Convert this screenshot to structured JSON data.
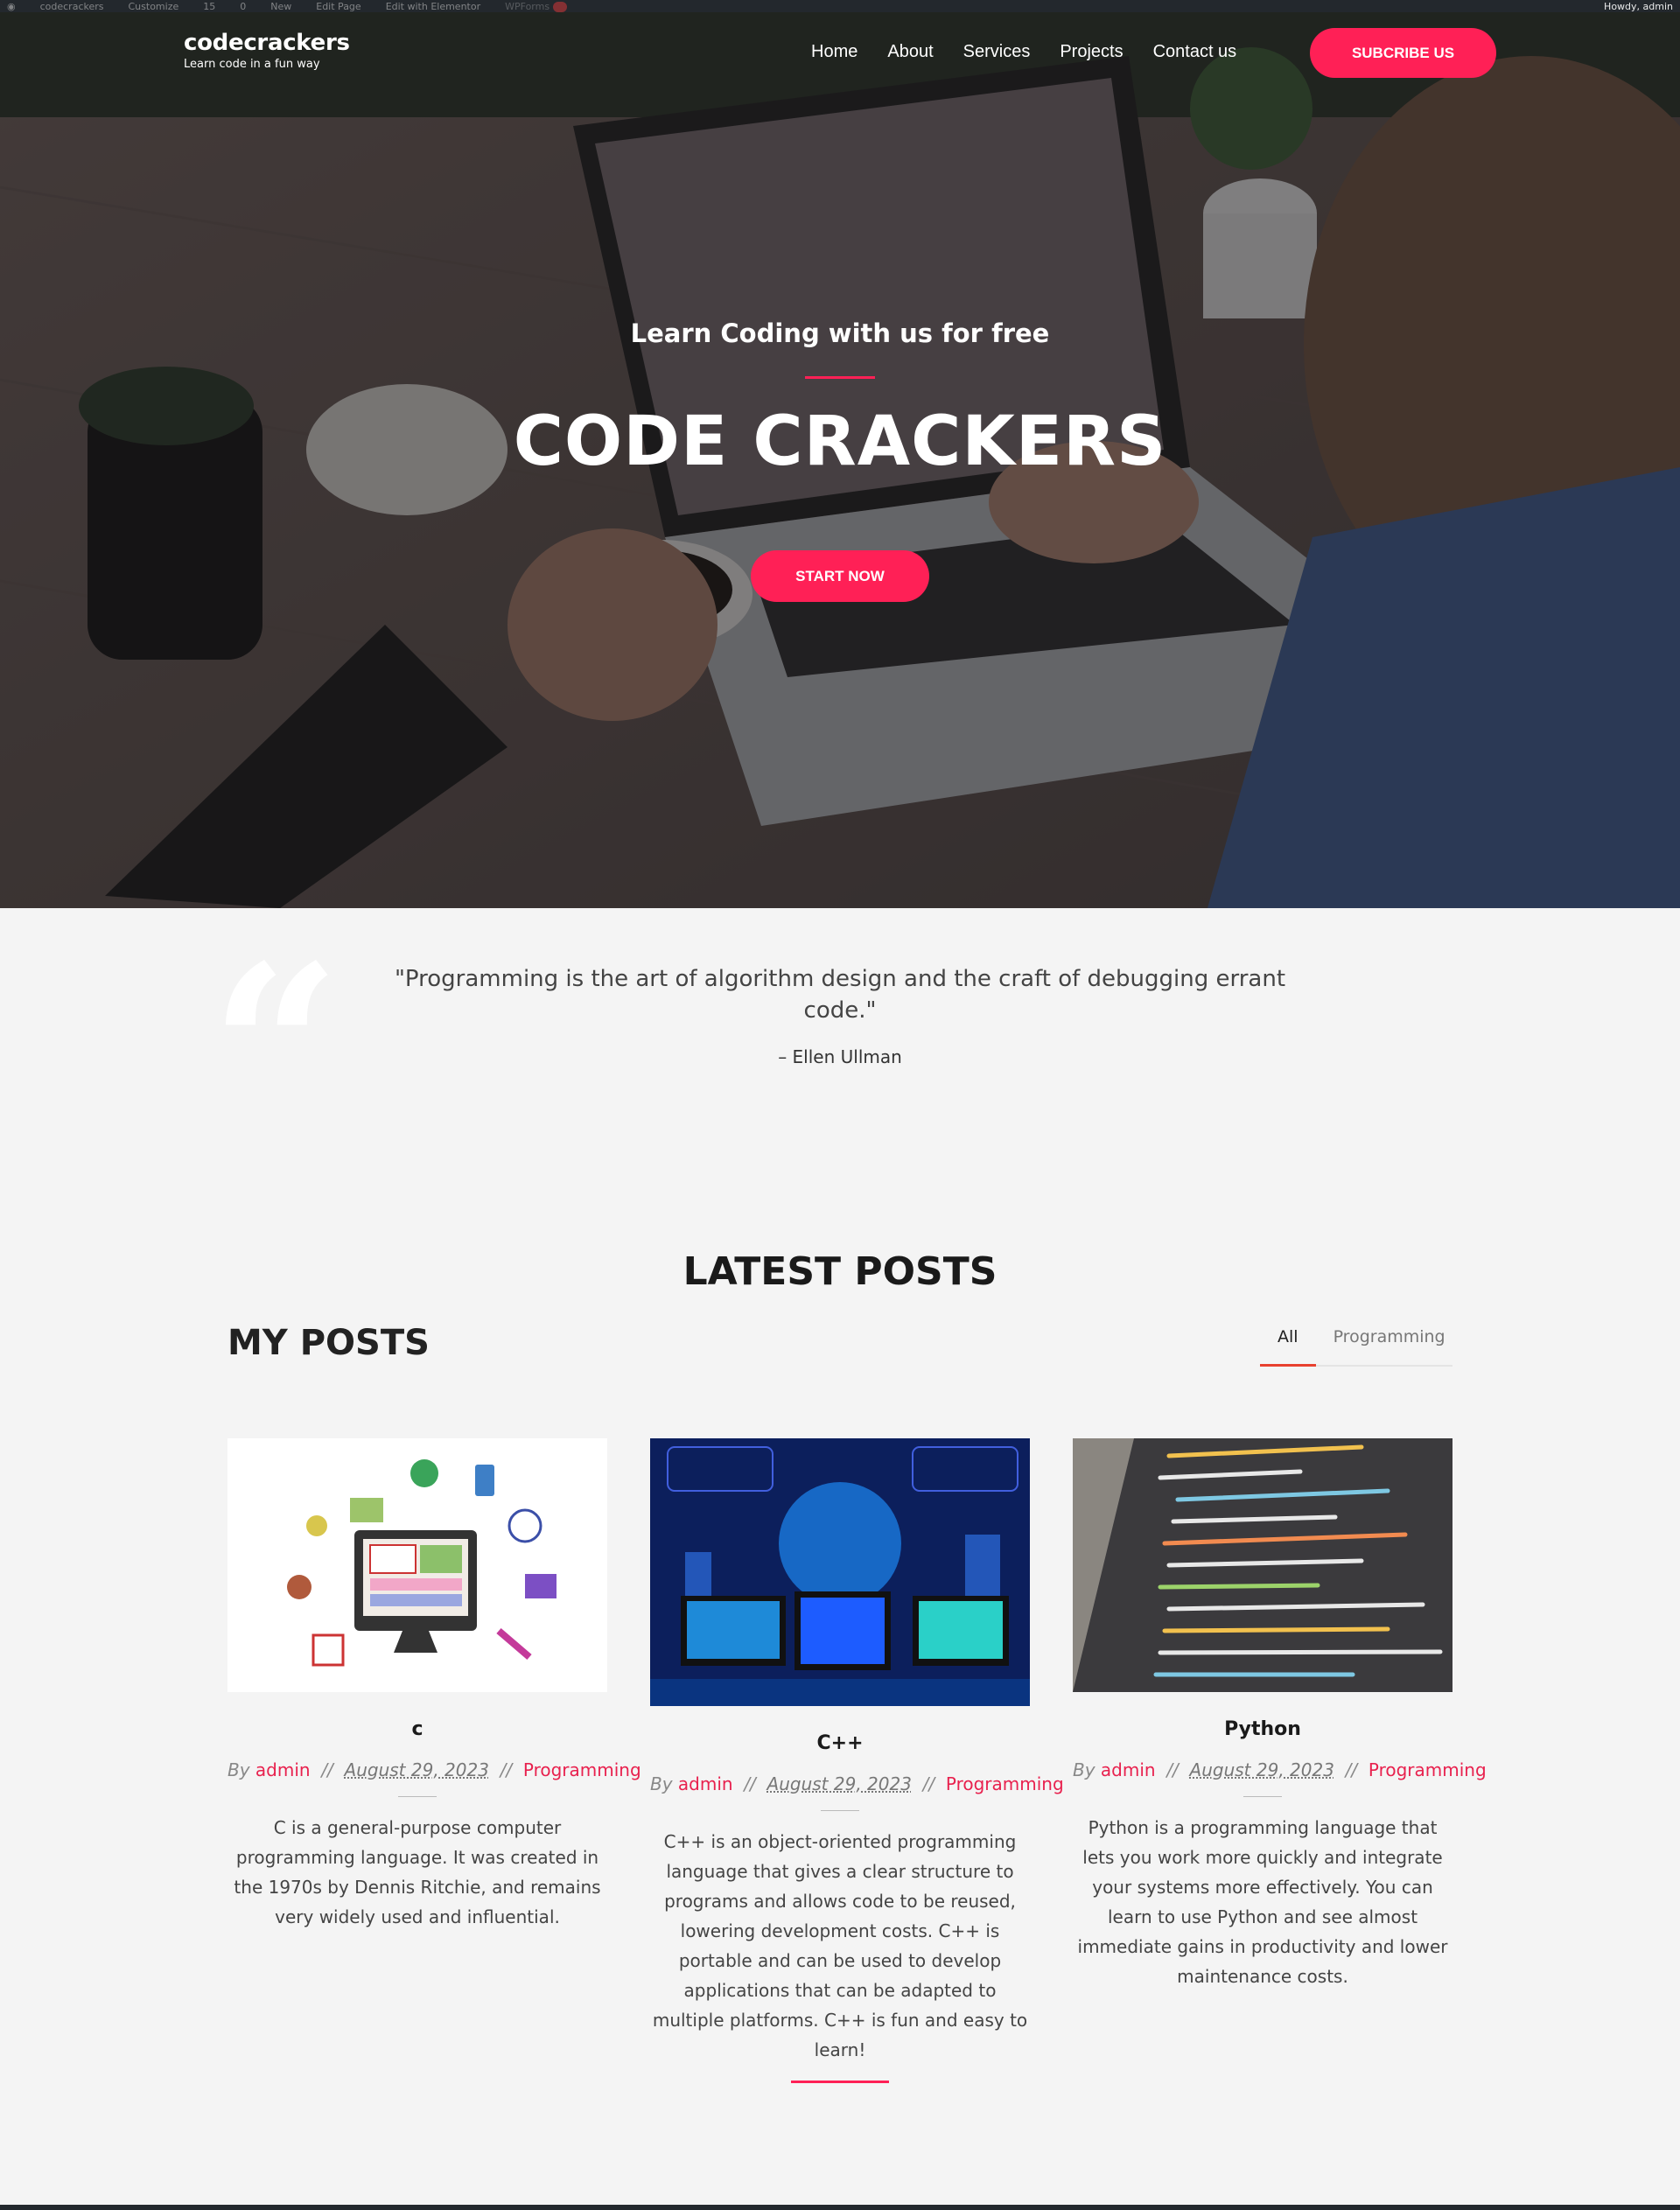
{
  "adminbar": {
    "items": [
      "codecrackers",
      "Customize",
      "15",
      "0",
      "New",
      "Edit Page",
      "Edit with Elementor",
      "WPForms"
    ],
    "greeting": "Howdy, admin"
  },
  "site": {
    "name": "codecrackers",
    "tagline": "Learn code in a fun way"
  },
  "nav": {
    "items": [
      "Home",
      "About",
      "Services",
      "Projects",
      "Contact us"
    ],
    "subscribe": "SUBCRIBE US"
  },
  "hero": {
    "subtitle": "Learn Coding with us for free",
    "title": "CODE CRACKERS",
    "cta": "START NOW"
  },
  "quote": {
    "text": "\"Programming is the art of algorithm design and the craft of debugging errant code.\"",
    "author": "– Ellen Ullman"
  },
  "sections": {
    "latest": "LATEST POSTS",
    "my_posts": "MY POSTS"
  },
  "filters": [
    "All",
    "Programming"
  ],
  "posts": [
    {
      "title": "c",
      "by": "By",
      "author": "admin",
      "sep": "//",
      "date": "August 29, 2023",
      "category": "Programming",
      "excerpt": "C is a general-purpose computer programming language. It was created in the 1970s by Dennis Ritchie, and remains very widely used and influential."
    },
    {
      "title": "C++",
      "by": "By",
      "author": "admin",
      "sep": "//",
      "date": "August 29, 2023",
      "category": "Programming",
      "excerpt": "C++ is an object-oriented programming language that gives a clear structure to programs and allows code to be reused, lowering development costs. C++ is portable and can be used to develop applications that can be adapted to multiple platforms. C++ is fun and easy to learn!"
    },
    {
      "title": "Python",
      "by": "By",
      "author": "admin",
      "sep": "//",
      "date": "August 29, 2023",
      "category": "Programming",
      "excerpt": "Python is a programming language that lets you work more quickly and integrate your systems more effectively. You can learn to use Python and see almost immediate gains in productivity and lower maintenance costs."
    }
  ],
  "colors": {
    "accent": "#ff2056",
    "tab_underline": "#e8412f",
    "page_bg": "#f4f4f4"
  }
}
